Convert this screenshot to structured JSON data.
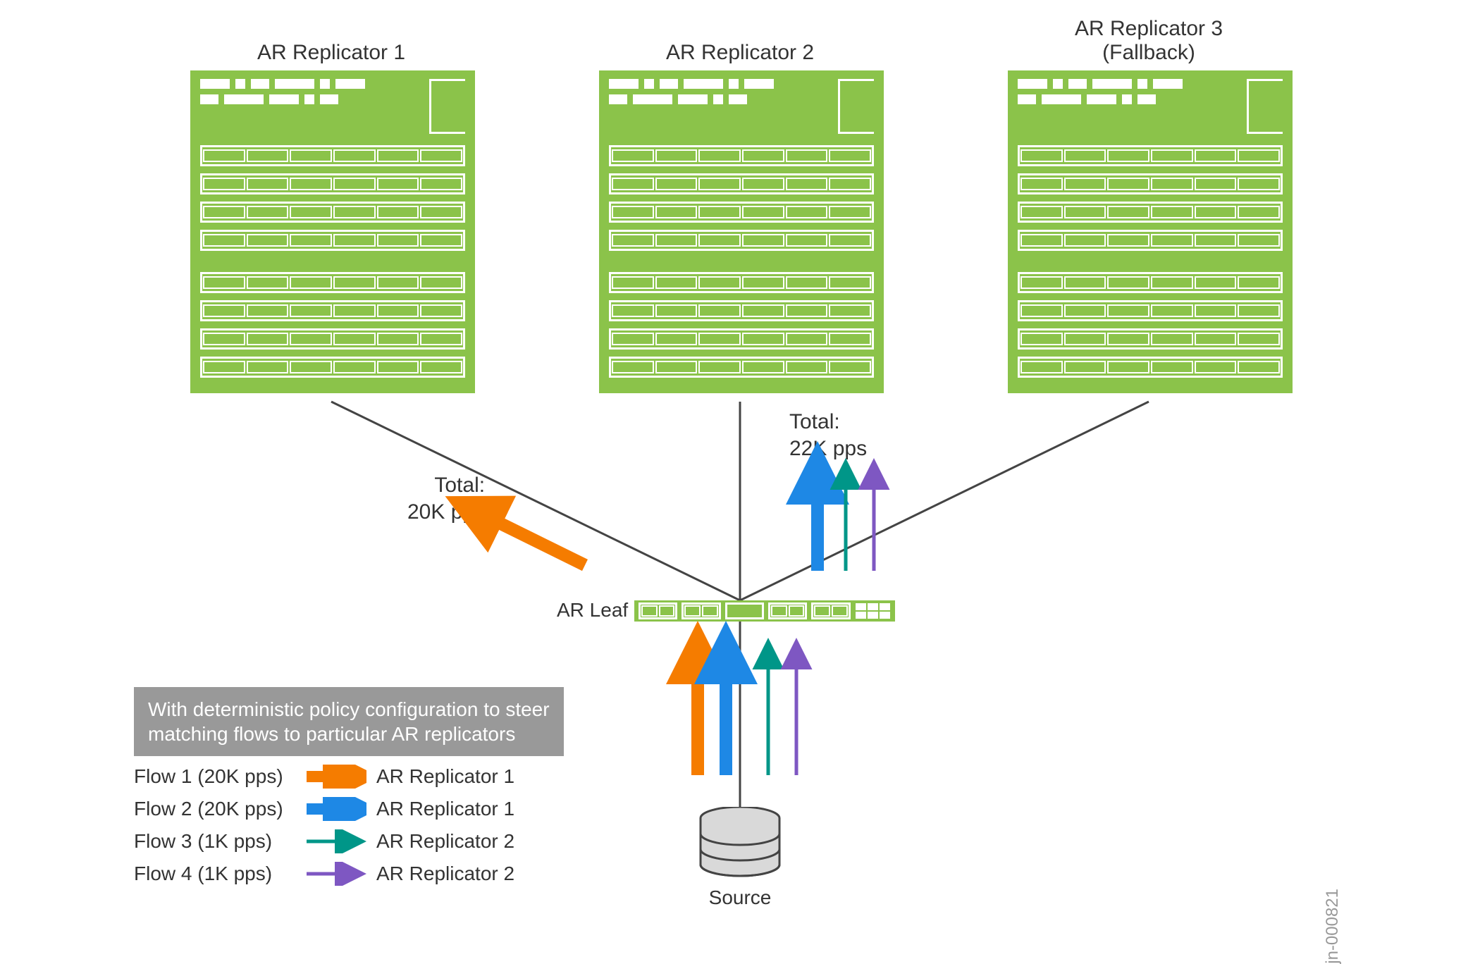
{
  "replicators": [
    {
      "label": "AR Replicator 1"
    },
    {
      "label": "AR Replicator 2"
    },
    {
      "label_line1": "AR Replicator 3",
      "label_line2": "(Fallback)"
    }
  ],
  "leaf_label": "AR Leaf",
  "source_label": "Source",
  "total1_label": "Total:",
  "total1_value": "20K pps",
  "total2_label": "Total:",
  "total2_value": "22K pps",
  "legend": {
    "title_line1": "With deterministic policy configuration to steer",
    "title_line2": "matching flows to particular AR replicators",
    "rows": [
      {
        "flow": "Flow 1 (20K pps)",
        "dest": "AR Replicator 1",
        "color": "#f57c00",
        "thick": true
      },
      {
        "flow": "Flow 2 (20K pps)",
        "dest": "AR Replicator 1",
        "color": "#1e88e5",
        "thick": true
      },
      {
        "flow": "Flow 3 (1K pps)",
        "dest": "AR Replicator 2",
        "color": "#009688",
        "thick": false
      },
      {
        "flow": "Flow 4 (1K pps)",
        "dest": "AR Replicator 2",
        "color": "#7e57c2",
        "thick": false
      }
    ]
  },
  "colors": {
    "server": "#8bc34a",
    "orange": "#f57c00",
    "blue": "#1e88e5",
    "teal": "#009688",
    "purple": "#7e57c2",
    "link": "#444444"
  },
  "image_id": "jn-000821",
  "chart_data": {
    "type": "diagram",
    "topology": {
      "source": "Source",
      "leaf": "AR Leaf",
      "replicators": [
        "AR Replicator 1",
        "AR Replicator 2",
        "AR Replicator 3 (Fallback)"
      ]
    },
    "flows": [
      {
        "name": "Flow 1",
        "pps": 20000,
        "steered_to": "AR Replicator 1"
      },
      {
        "name": "Flow 2",
        "pps": 20000,
        "steered_to": "AR Replicator 1"
      },
      {
        "name": "Flow 3",
        "pps": 1000,
        "steered_to": "AR Replicator 2"
      },
      {
        "name": "Flow 4",
        "pps": 1000,
        "steered_to": "AR Replicator 2"
      }
    ],
    "link_totals": [
      {
        "from": "AR Leaf",
        "to": "AR Replicator 1",
        "total_pps": 20000,
        "label": "20K pps"
      },
      {
        "from": "AR Leaf",
        "to": "AR Replicator 2",
        "total_pps": 22000,
        "label": "22K pps"
      }
    ],
    "note": "Deterministic policy configuration steers matching flows to particular AR replicators"
  }
}
